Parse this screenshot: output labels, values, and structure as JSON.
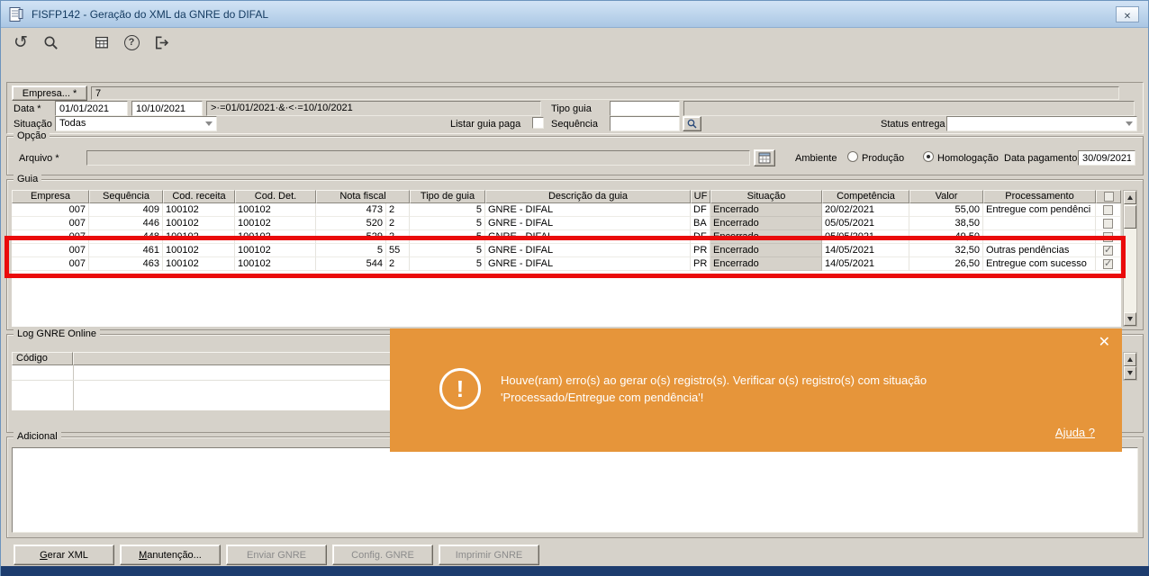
{
  "window": {
    "title": "FISFP142 - Geração do XML da GNRE do DIFAL"
  },
  "toolbar": {
    "icons": [
      "undo",
      "search",
      "calendar",
      "help",
      "exit"
    ]
  },
  "filters": {
    "empresa_button_label": "Empresa... *",
    "empresa_value": "7",
    "data_label": "Data *",
    "data_start": "01/01/2021",
    "data_end": "10/10/2021",
    "data_range_expr": ">·=01/01/2021·&·<·=10/10/2021",
    "tipo_guia_label": "Tipo guia",
    "tipo_guia_value": "",
    "situacao_label": "Situação *",
    "situacao_value": "Todas",
    "listar_guia_paga_label": "Listar guia paga",
    "listar_guia_paga_checked": false,
    "sequencia_label": "Sequência",
    "sequencia_value": "",
    "status_entrega_label": "Status entrega",
    "status_entrega_value": ""
  },
  "opcao": {
    "legend": "Opção",
    "arquivo_label": "Arquivo *",
    "arquivo_value": "",
    "ambiente_label": "Ambiente",
    "producao_label": "Produção",
    "homologacao_label": "Homologação",
    "ambiente_selected": "Homologação",
    "data_pagamento_label": "Data pagamento",
    "data_pagamento_value": "30/09/2021"
  },
  "guia": {
    "legend": "Guia",
    "columns": [
      "Empresa",
      "Sequência",
      "Cod. receita",
      "Cod. Det.",
      "Nota fiscal",
      "Tipo de guia",
      "Descrição da guia",
      "UF",
      "Situação",
      "Competência",
      "Valor",
      "Processamento"
    ],
    "rows": [
      {
        "empresa": "007",
        "sequencia": "409",
        "cod_receita": "100102",
        "cod_det": "100102",
        "nota_fiscal": "473",
        "serie": "2",
        "tipo_guia": "5",
        "descricao": "GNRE - DIFAL",
        "uf": "DF",
        "situacao": "Encerrado",
        "competencia": "20/02/2021",
        "valor": "55,00",
        "processamento": "Entregue com pendênci",
        "checked": false
      },
      {
        "empresa": "007",
        "sequencia": "446",
        "cod_receita": "100102",
        "cod_det": "100102",
        "nota_fiscal": "520",
        "serie": "2",
        "tipo_guia": "5",
        "descricao": "GNRE - DIFAL",
        "uf": "BA",
        "situacao": "Encerrado",
        "competencia": "05/05/2021",
        "valor": "38,50",
        "processamento": "",
        "checked": false
      },
      {
        "empresa": "007",
        "sequencia": "448",
        "cod_receita": "100102",
        "cod_det": "100102",
        "nota_fiscal": "529",
        "serie": "2",
        "tipo_guia": "5",
        "descricao": "GNRE - DIFAL",
        "uf": "DF",
        "situacao": "Encerrado",
        "competencia": "05/05/2021",
        "valor": "49,50",
        "processamento": "",
        "checked": false
      },
      {
        "empresa": "007",
        "sequencia": "461",
        "cod_receita": "100102",
        "cod_det": "100102",
        "nota_fiscal": "5",
        "serie": "55",
        "tipo_guia": "5",
        "descricao": "GNRE - DIFAL",
        "uf": "PR",
        "situacao": "Encerrado",
        "competencia": "14/05/2021",
        "valor": "32,50",
        "processamento": "Outras pendências",
        "checked": true
      },
      {
        "empresa": "007",
        "sequencia": "463",
        "cod_receita": "100102",
        "cod_det": "100102",
        "nota_fiscal": "544",
        "serie": "2",
        "tipo_guia": "5",
        "descricao": "GNRE - DIFAL",
        "uf": "PR",
        "situacao": "Encerrado",
        "competencia": "14/05/2021",
        "valor": "26,50",
        "processamento": "Entregue com sucesso",
        "checked": true
      }
    ]
  },
  "log": {
    "legend": "Log GNRE Online",
    "codigo_header": "Código"
  },
  "toast": {
    "line1": "Houve(ram) erro(s) ao gerar o(s) registro(s). Verificar o(s) registro(s) com situação",
    "line2": "'Processado/Entregue com pendência'!",
    "help_label": "Ajuda ?"
  },
  "adicional": {
    "legend": "Adicional",
    "value": ""
  },
  "actions": {
    "buttons": [
      {
        "label": "Gerar XML",
        "mnemonic_index": 0,
        "enabled": true
      },
      {
        "label": "Manutenção...",
        "mnemonic_index": 0,
        "enabled": true
      },
      {
        "label": "Enviar GNRE",
        "mnemonic_index": -1,
        "enabled": false
      },
      {
        "label": "Config. GNRE",
        "mnemonic_index": -1,
        "enabled": false
      },
      {
        "label": "Imprimir GNRE",
        "mnemonic_index": -1,
        "enabled": false
      }
    ]
  },
  "colors": {
    "titlebar": "#b7d0e9",
    "toast_background": "#e6953a",
    "highlight_box": "#ea0b0b",
    "statusbar": "#1d3c6e"
  }
}
